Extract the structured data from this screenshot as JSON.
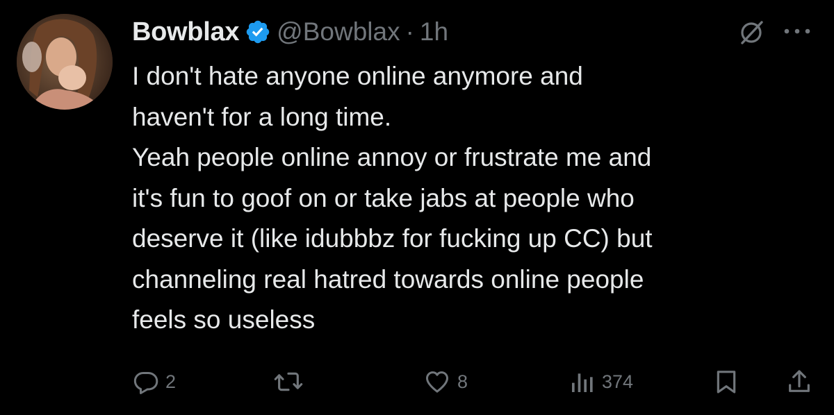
{
  "tweet": {
    "display_name": "Bowblax",
    "handle": "@Bowblax",
    "separator": "·",
    "time": "1h",
    "verified_icon": "verified-badge-icon",
    "text_lines": [
      "I don't hate anyone online anymore and",
      "haven't for a long time.",
      "Yeah people online annoy or frustrate me and",
      "it's fun to goof on or take jabs at people who",
      "deserve it (like idubbbz for fucking up CC) but",
      "channeling real hatred towards online people",
      "feels so useless"
    ]
  },
  "actions": {
    "reply_count": "2",
    "retweet_count": "",
    "like_count": "8",
    "views_count": "374"
  },
  "colors": {
    "background": "#000000",
    "text_primary": "#e7e9ea",
    "text_secondary": "#71767b",
    "verified_blue": "#1d9bf0"
  }
}
